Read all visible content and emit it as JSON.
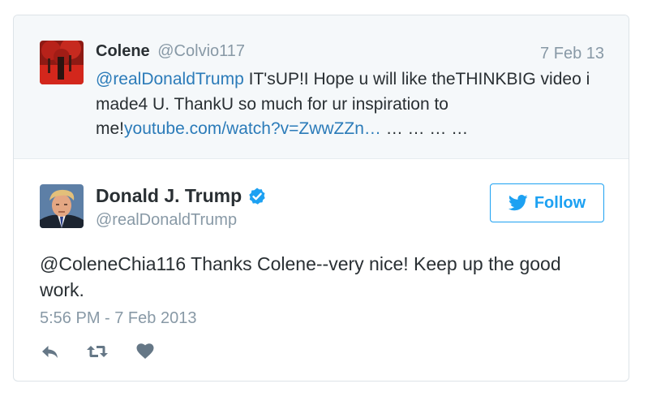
{
  "quoted_tweet": {
    "author_name": "Colene",
    "author_handle": "@Colvio117",
    "date": "7 Feb 13",
    "mention": "@realDonaldTrump",
    "text": " IT'sUP!I Hope u will like theTHINKBIG video i made4 U. ThankU so much for ur inspiration to me!",
    "link_text": "youtube.com/watch?v=ZwwZZn…",
    "trailing_text": " … … … …"
  },
  "tweet": {
    "author_name": "Donald J. Trump",
    "author_handle": "@realDonaldTrump",
    "follow_label": "Follow",
    "text": "@ColeneChia116 Thanks Colene--very nice! Keep up the good work.",
    "timestamp": "5:56 PM - 7 Feb 2013"
  },
  "icons": {
    "verified": "verified-badge-icon",
    "bird": "twitter-bird-icon",
    "reply": "reply-icon",
    "retweet": "retweet-icon",
    "like": "heart-icon"
  },
  "colors": {
    "link": "#2b7bb9",
    "brand": "#1da1f2",
    "muted": "#8899a6",
    "text": "#292f33",
    "quoted_bg": "#f5f8fa"
  }
}
